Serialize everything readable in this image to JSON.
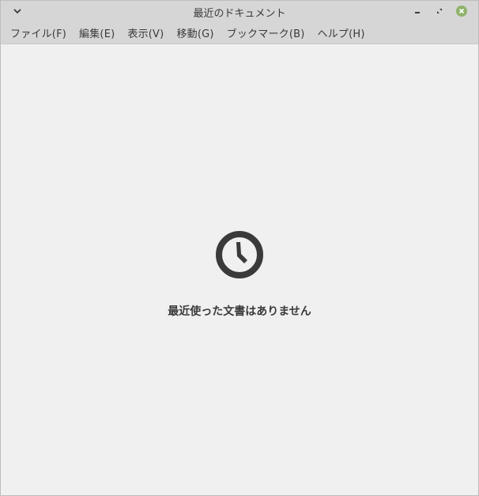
{
  "window": {
    "title": "最近のドキュメント"
  },
  "menubar": {
    "items": [
      {
        "label": "ファイル(F)"
      },
      {
        "label": "編集(E)"
      },
      {
        "label": "表示(V)"
      },
      {
        "label": "移動(G)"
      },
      {
        "label": "ブックマーク(B)"
      },
      {
        "label": "ヘルプ(H)"
      }
    ]
  },
  "empty_state": {
    "icon": "clock-icon",
    "message": "最近使った文書はありません"
  },
  "colors": {
    "titlebar": "#d6d6d6",
    "background": "#f0f0f0",
    "close_button": "#8fb36a",
    "text": "#3a3a3a"
  }
}
